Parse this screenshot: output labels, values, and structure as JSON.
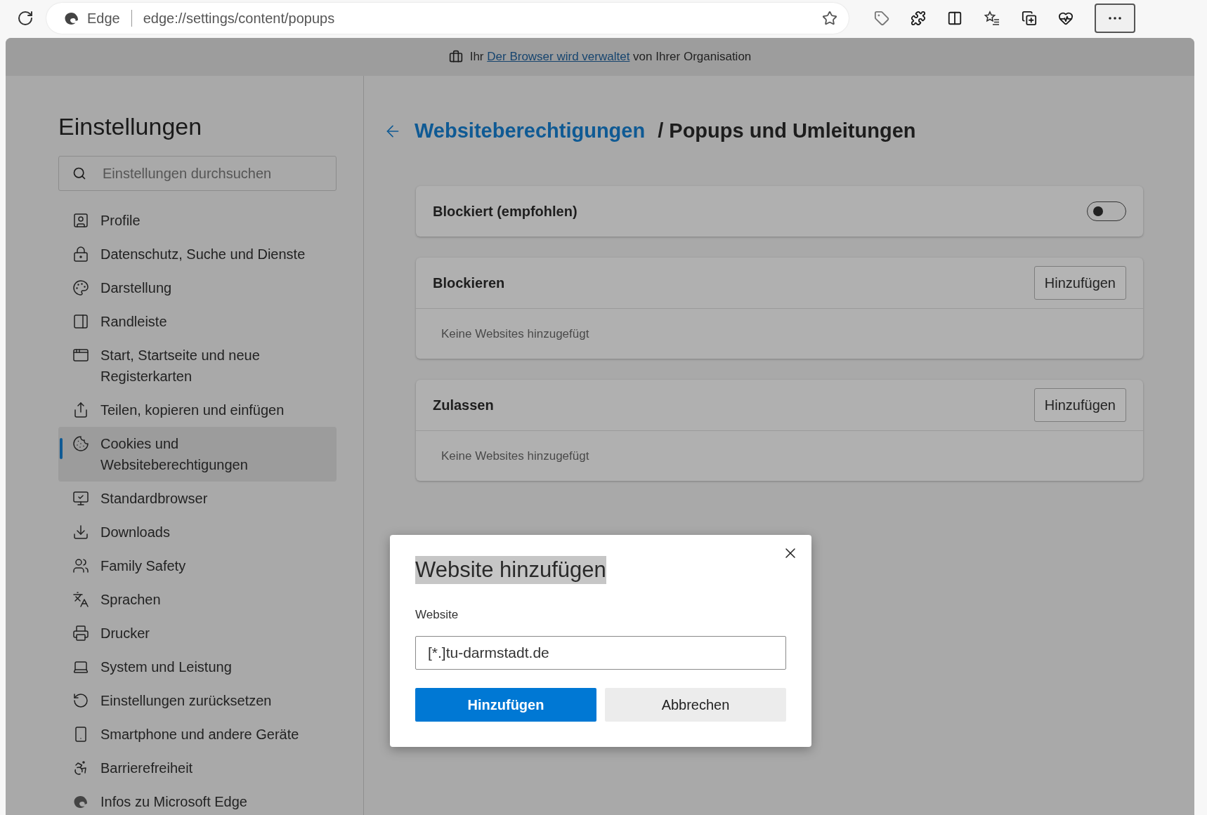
{
  "browser": {
    "site_label": "Edge",
    "url": "edge://settings/content/popups",
    "more_selected": true
  },
  "banner": {
    "before": "Ihr",
    "link": "Der Browser wird verwaltet",
    "after": "von Ihrer Organisation"
  },
  "sidebar": {
    "title": "Einstellungen",
    "search": {
      "placeholder": "Einstellungen durchsuchen"
    },
    "items": [
      {
        "label": "Profile",
        "selected": false
      },
      {
        "label": "Datenschutz, Suche und Dienste",
        "selected": false
      },
      {
        "label": "Darstellung",
        "selected": false
      },
      {
        "label": "Randleiste",
        "selected": false
      },
      {
        "label": "Start, Startseite und neue Registerkarten",
        "selected": false
      },
      {
        "label": "Teilen, kopieren und einfügen",
        "selected": false
      },
      {
        "label": "Cookies und Websiteberechtigungen",
        "selected": true
      },
      {
        "label": "Standardbrowser",
        "selected": false
      },
      {
        "label": "Downloads",
        "selected": false
      },
      {
        "label": "Family Safety",
        "selected": false
      },
      {
        "label": "Sprachen",
        "selected": false
      },
      {
        "label": "Drucker",
        "selected": false
      },
      {
        "label": "System und Leistung",
        "selected": false
      },
      {
        "label": "Einstellungen zurücksetzen",
        "selected": false
      },
      {
        "label": "Smartphone und andere Geräte",
        "selected": false
      },
      {
        "label": "Barrierefreiheit",
        "selected": false
      },
      {
        "label": "Infos zu Microsoft Edge",
        "selected": false
      }
    ]
  },
  "header": {
    "parent": "Websiteberechtigungen",
    "separator": "/",
    "title": "Popups und Umleitungen"
  },
  "cards": [
    {
      "kind": "toggle",
      "label": "Blockiert (empfohlen)",
      "on": false
    },
    {
      "kind": "list",
      "label": "Blockieren",
      "button": "Hinzufügen",
      "empty_text": "Keine Websites hinzugefügt"
    },
    {
      "kind": "list",
      "label": "Zulassen",
      "button": "Hinzufügen",
      "empty_text": "Keine Websites hinzugefügt"
    }
  ],
  "dialog": {
    "title": "Website hinzufügen",
    "title_highlighted": true,
    "field_label": "Website",
    "value": "[*.]tu-darmstadt.de",
    "primary": "Hinzufügen",
    "secondary": "Abbrechen"
  }
}
